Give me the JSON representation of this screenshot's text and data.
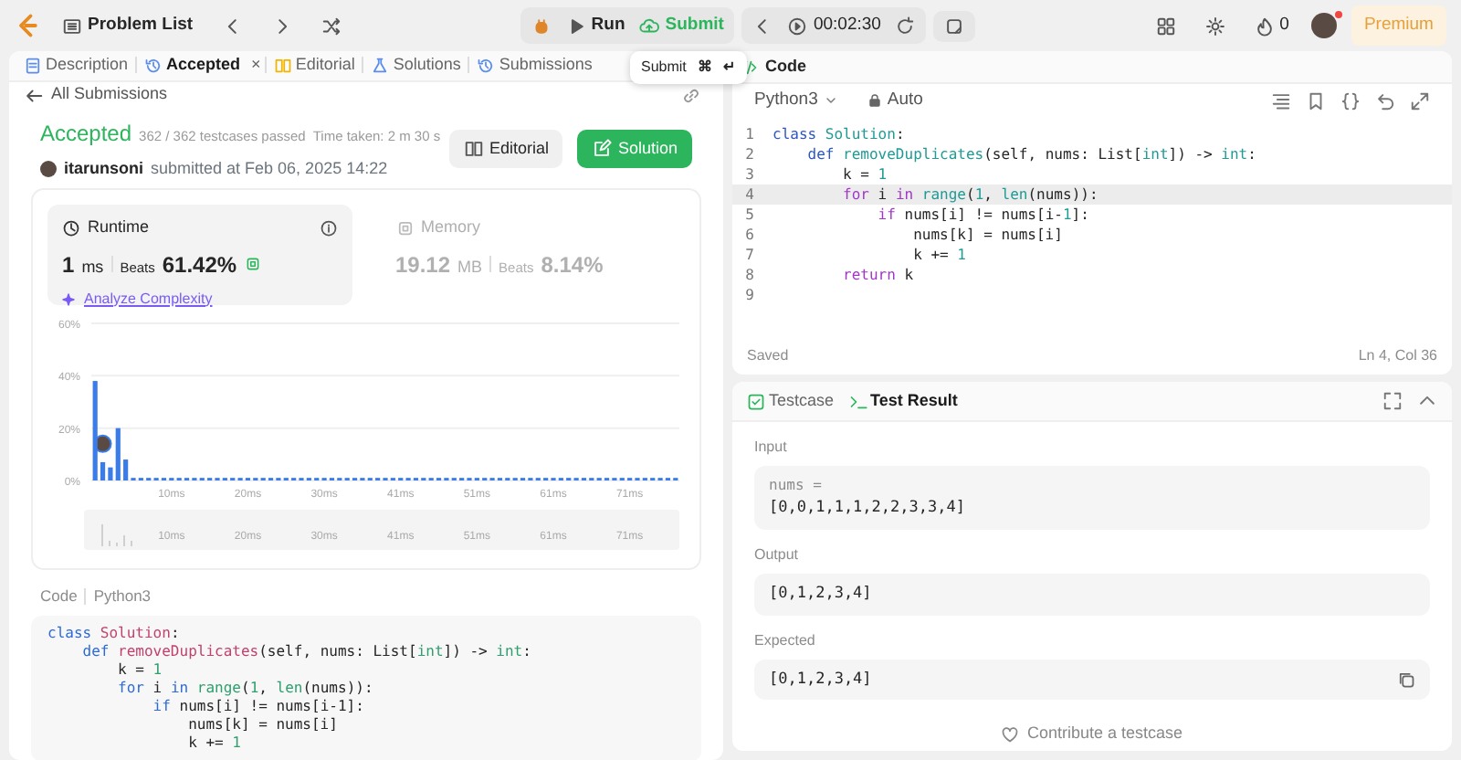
{
  "top_bar": {
    "problem_list": "Problem List",
    "run": "Run",
    "submit": "Submit",
    "timer": "00:02:30",
    "streak": "0",
    "premium": "Premium",
    "notification": true
  },
  "tooltip": {
    "label": "Submit",
    "keys": [
      "⌘",
      "↵"
    ]
  },
  "left_tabs": [
    {
      "label": "Description",
      "selected": false
    },
    {
      "label": "Accepted",
      "selected": true,
      "close": "×"
    },
    {
      "label": "Editorial",
      "selected": false
    },
    {
      "label": "Solutions",
      "selected": false
    },
    {
      "label": "Submissions",
      "selected": false
    }
  ],
  "back_link": "All Submissions",
  "result": {
    "status": "Accepted",
    "passed": "362 / 362 testcases passed",
    "time_taken": "Time taken: 2 m 30 s",
    "user": "itarunsoni",
    "submitted": "submitted at Feb 06, 2025 14:22",
    "buttons": [
      "Editorial",
      "Solution"
    ]
  },
  "metrics": [
    {
      "title": "Runtime",
      "value": "1",
      "unit": "ms",
      "beats_label": "Beats",
      "beats": "61.42%",
      "selected": true,
      "action": "Analyze Complexity"
    },
    {
      "title": "Memory",
      "value": "19.12",
      "unit": "MB",
      "beats_label": "Beats",
      "beats": "8.14%",
      "selected": false
    }
  ],
  "chart_data": {
    "type": "bar",
    "ylim": [
      0,
      60
    ],
    "yticks": [
      {
        "value": 0,
        "label": "0%"
      },
      {
        "value": 20,
        "label": "20%"
      },
      {
        "value": 40,
        "label": "40%"
      },
      {
        "value": 60,
        "label": "60%"
      }
    ],
    "categories": [
      null,
      null,
      null,
      null,
      null,
      null,
      null,
      null,
      null,
      null,
      "10ms",
      null,
      null,
      null,
      null,
      null,
      null,
      null,
      null,
      null,
      "20ms",
      null,
      null,
      null,
      null,
      null,
      null,
      null,
      null,
      null,
      "30ms",
      null,
      null,
      null,
      null,
      null,
      null,
      null,
      null,
      null,
      "41ms",
      null,
      null,
      null,
      null,
      null,
      null,
      null,
      null,
      null,
      "51ms",
      null,
      null,
      null,
      null,
      null,
      null,
      null,
      null,
      null,
      "61ms",
      null,
      null,
      null,
      null,
      null,
      null,
      null,
      null,
      null,
      "71ms",
      null,
      null,
      null,
      null,
      null,
      null
    ],
    "values": [
      38,
      7,
      5,
      20,
      8,
      1,
      1,
      1,
      1,
      1,
      1,
      1,
      1,
      1,
      1,
      1,
      1,
      1,
      1,
      1,
      1,
      1,
      1,
      1,
      1,
      1,
      1,
      1,
      1,
      1,
      1,
      1,
      1,
      1,
      1,
      1,
      1,
      1,
      1,
      1,
      1,
      1,
      1,
      1,
      1,
      1,
      1,
      1,
      1,
      1,
      1,
      1,
      1,
      1,
      1,
      1,
      1,
      1,
      1,
      1,
      1,
      1,
      1,
      1,
      1,
      1,
      1,
      1,
      1,
      1,
      1,
      1,
      1,
      1,
      1,
      1,
      1
    ]
  },
  "brush_labels": [
    "10ms",
    "20ms",
    "30ms",
    "41ms",
    "51ms",
    "61ms",
    "71ms"
  ],
  "code_view": {
    "label": "Code",
    "language": "Python3",
    "lines": [
      {
        "tokens": [
          {
            "kind": "kw",
            "text": "class"
          },
          {
            "kind": "name",
            "text": " Solution"
          },
          {
            "kind": "plain",
            "text": ":"
          }
        ]
      },
      {
        "tokens": [
          {
            "kind": "kw",
            "text": "    def"
          },
          {
            "kind": "name",
            "text": " removeDuplicates"
          },
          {
            "kind": "plain",
            "text": "(self, nums: List["
          },
          {
            "kind": "type",
            "text": "int"
          },
          {
            "kind": "plain",
            "text": "]) -> "
          },
          {
            "kind": "type",
            "text": "int"
          },
          {
            "kind": "plain",
            "text": ":"
          }
        ]
      },
      {
        "tokens": [
          {
            "kind": "plain",
            "text": "        k = "
          },
          {
            "kind": "num",
            "text": "1"
          }
        ]
      },
      {
        "tokens": [
          {
            "kind": "kw",
            "text": "        for"
          },
          {
            "kind": "plain",
            "text": " i "
          },
          {
            "kind": "kw",
            "text": "in"
          },
          {
            "kind": "builtin",
            "text": " range"
          },
          {
            "kind": "plain",
            "text": "("
          },
          {
            "kind": "num",
            "text": "1"
          },
          {
            "kind": "plain",
            "text": ", "
          },
          {
            "kind": "builtin",
            "text": "len"
          },
          {
            "kind": "plain",
            "text": "(nums)):"
          }
        ]
      },
      {
        "tokens": [
          {
            "kind": "kw",
            "text": "            if"
          },
          {
            "kind": "plain",
            "text": " nums[i] != nums[i-1]:"
          }
        ]
      },
      {
        "tokens": [
          {
            "kind": "plain",
            "text": "                nums[k] = nums[i]"
          }
        ]
      },
      {
        "tokens": [
          {
            "kind": "plain",
            "text": "                k += "
          },
          {
            "kind": "num",
            "text": "1"
          }
        ]
      }
    ]
  },
  "editor": {
    "title": "Code",
    "language": "Python3",
    "mode": "Auto",
    "status": "Saved",
    "cursor": "Ln 4, Col 36",
    "lines": [
      {
        "number": "1",
        "current": false,
        "tokens": [
          {
            "kind": "kw",
            "text": "class"
          },
          {
            "kind": "name",
            "text": " Solution"
          },
          {
            "kind": "plain",
            "text": ":"
          }
        ]
      },
      {
        "number": "2",
        "current": false,
        "tokens": [
          {
            "kind": "kw",
            "text": "    def"
          },
          {
            "kind": "name",
            "text": " removeDuplicates"
          },
          {
            "kind": "plain",
            "text": "(self, nums: List["
          },
          {
            "kind": "type",
            "text": "int"
          },
          {
            "kind": "plain",
            "text": "]) -> "
          },
          {
            "kind": "type",
            "text": "int"
          },
          {
            "kind": "plain",
            "text": ":"
          }
        ]
      },
      {
        "number": "3",
        "current": false,
        "tokens": [
          {
            "kind": "plain",
            "text": "        k = "
          },
          {
            "kind": "num",
            "text": "1"
          }
        ]
      },
      {
        "number": "4",
        "current": true,
        "tokens": [
          {
            "kind": "ctrl",
            "text": "        for"
          },
          {
            "kind": "plain",
            "text": " i "
          },
          {
            "kind": "ctrl",
            "text": "in"
          },
          {
            "kind": "builtin",
            "text": " range"
          },
          {
            "kind": "plain",
            "text": "("
          },
          {
            "kind": "num",
            "text": "1"
          },
          {
            "kind": "plain",
            "text": ", "
          },
          {
            "kind": "builtin",
            "text": "len"
          },
          {
            "kind": "plain",
            "text": "(nums)):"
          }
        ]
      },
      {
        "number": "5",
        "current": false,
        "tokens": [
          {
            "kind": "ctrl",
            "text": "            if"
          },
          {
            "kind": "plain",
            "text": " nums[i] != nums[i-"
          },
          {
            "kind": "num",
            "text": "1"
          },
          {
            "kind": "plain",
            "text": "]:"
          }
        ]
      },
      {
        "number": "6",
        "current": false,
        "tokens": [
          {
            "kind": "plain",
            "text": "                nums[k] = nums[i]"
          }
        ]
      },
      {
        "number": "7",
        "current": false,
        "tokens": [
          {
            "kind": "plain",
            "text": "                k += "
          },
          {
            "kind": "num",
            "text": "1"
          }
        ]
      },
      {
        "number": "8",
        "current": false,
        "tokens": [
          {
            "kind": "ctrl",
            "text": "        return"
          },
          {
            "kind": "plain",
            "text": " k"
          }
        ]
      },
      {
        "number": "9",
        "current": false
      }
    ]
  },
  "test_panel": {
    "tabs": [
      {
        "label": "Testcase",
        "selected": false
      },
      {
        "label": "Test Result",
        "selected": true
      }
    ],
    "sections": [
      {
        "label": "Input",
        "param": "nums =",
        "value": "[0,0,1,1,1,2,2,3,3,4]",
        "copyable": false
      },
      {
        "label": "Output",
        "value": "[0,1,2,3,4]",
        "copyable": false
      },
      {
        "label": "Expected",
        "value": "[0,1,2,3,4]",
        "copyable": true
      }
    ],
    "contribute": "Contribute a testcase"
  }
}
